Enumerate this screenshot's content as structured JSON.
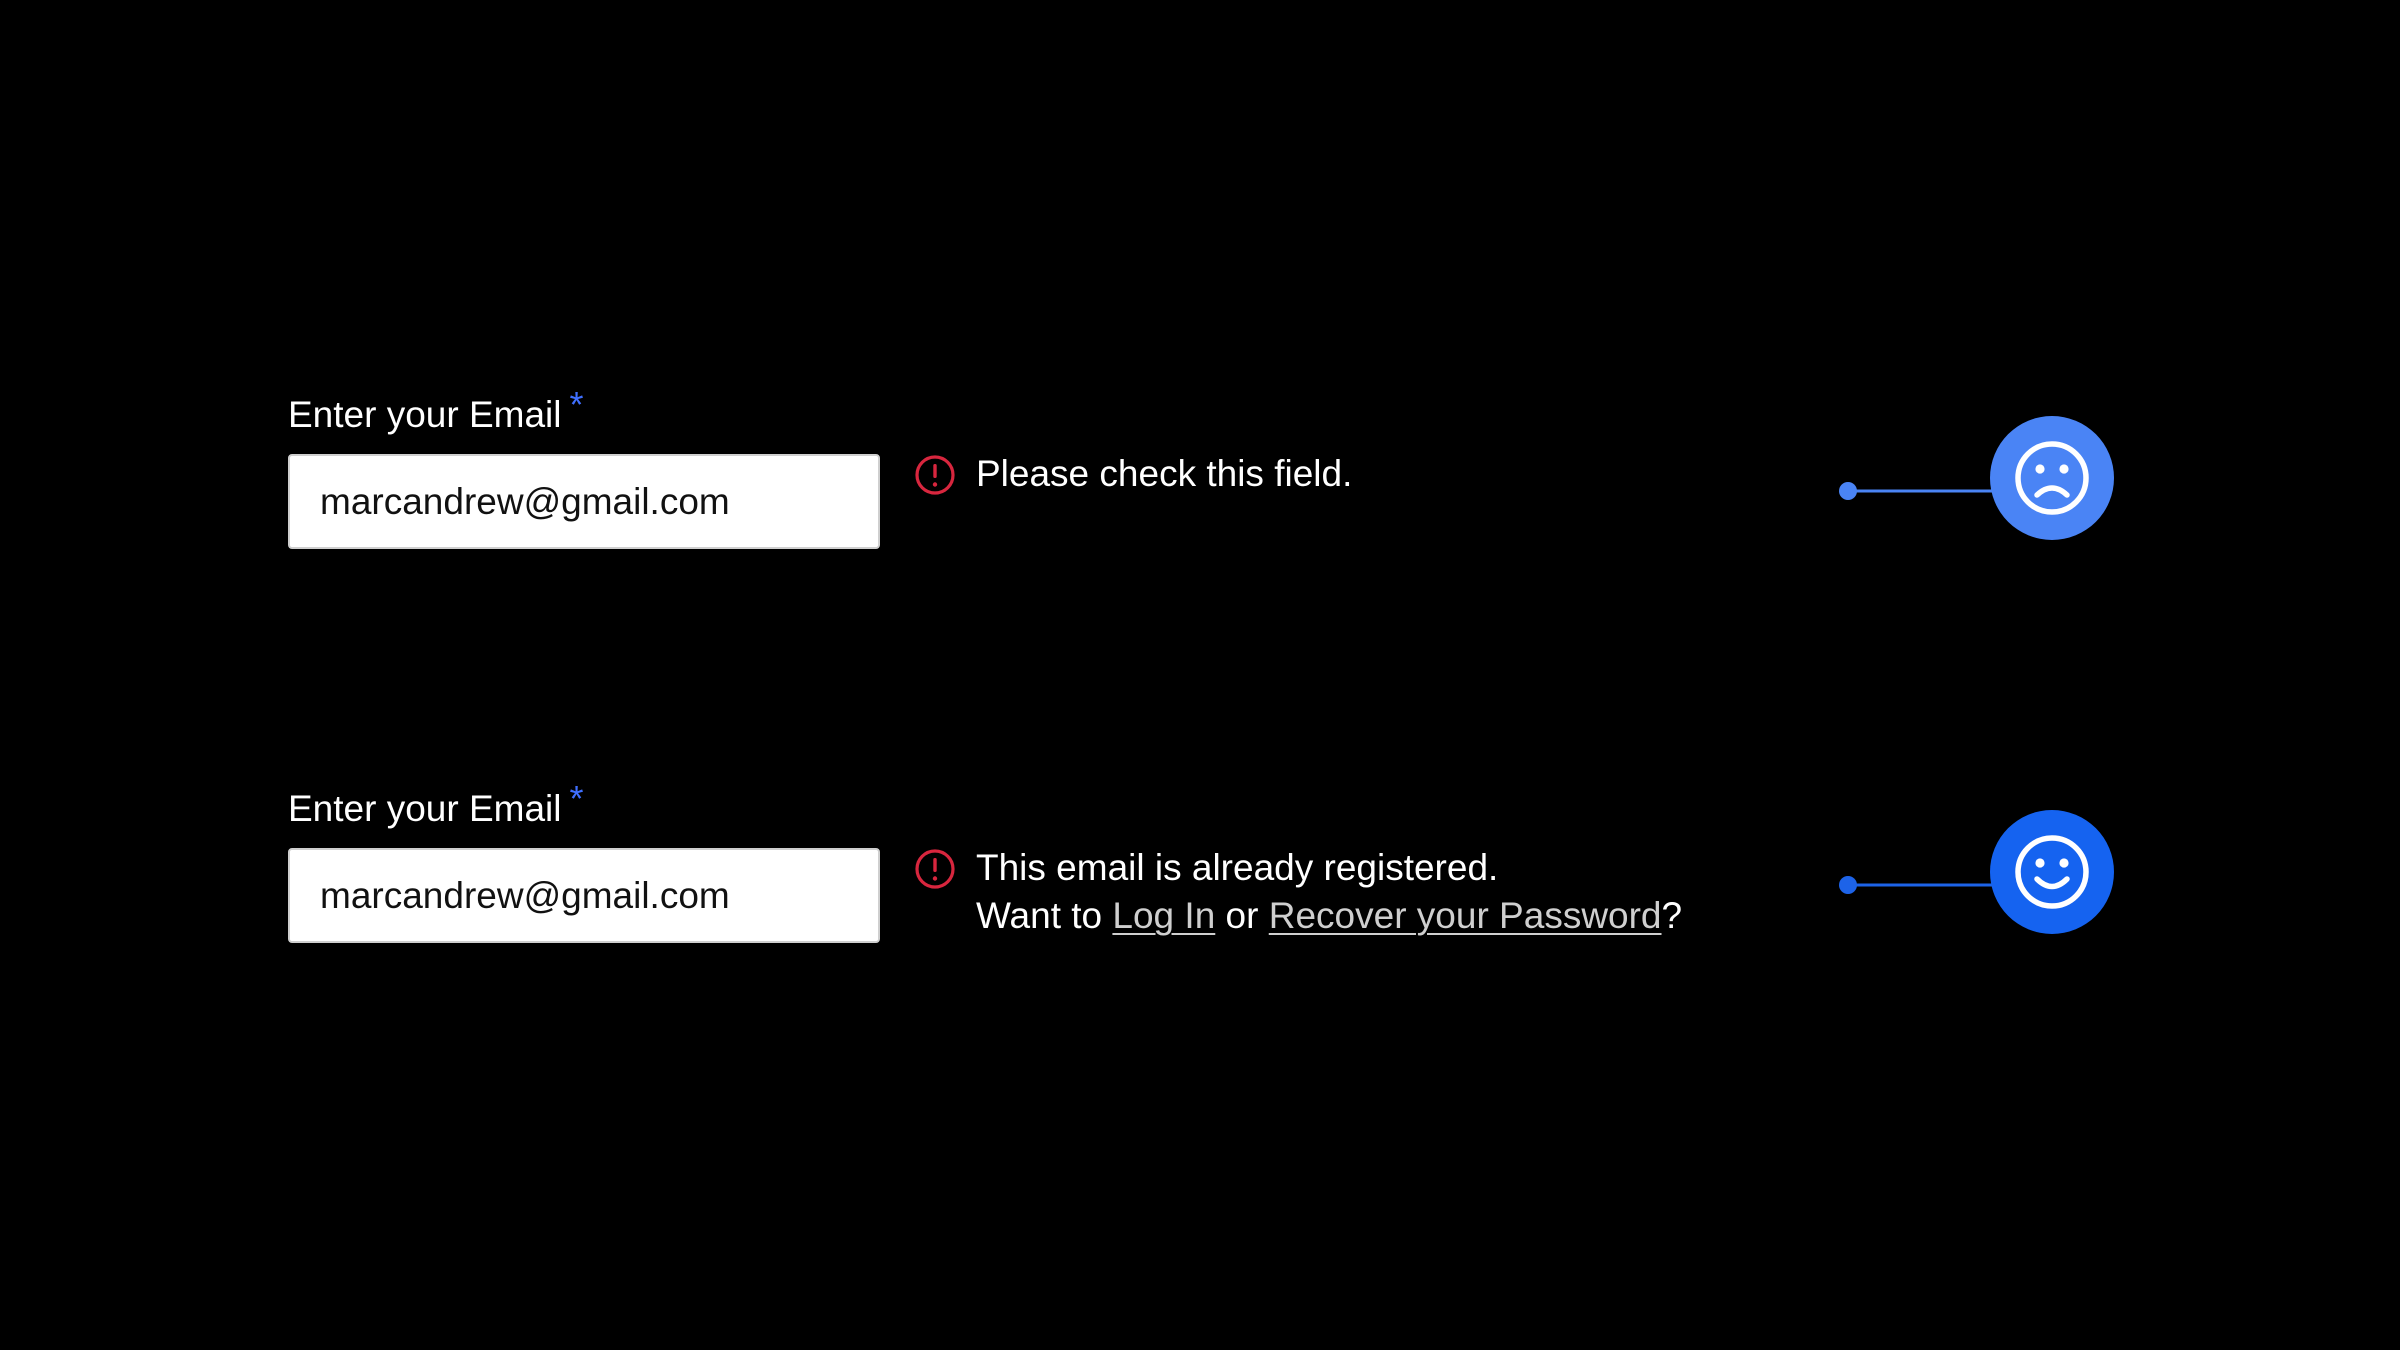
{
  "colors": {
    "background": "#000000",
    "required_asterisk": "#3f6fff",
    "error_red": "#d8263e",
    "sad_badge": "#4a84f5",
    "happy_badge": "#1563f0",
    "connector_sad": "#4a84f5",
    "connector_happy": "#1d63e8"
  },
  "rows": [
    {
      "label": "Enter your Email",
      "required_mark": "*",
      "input_value": "marcandrew@gmail.com",
      "error_icon": "exclamation-circle-icon",
      "error_message": "Please check this field.",
      "face_icon": "sad-face-icon"
    },
    {
      "label": "Enter your Email",
      "required_mark": "*",
      "input_value": "marcandrew@gmail.com",
      "error_icon": "exclamation-circle-icon",
      "error_message": "This email is already registered.",
      "followup_prefix": "Want to ",
      "login_link": "Log In",
      "followup_middle": " or ",
      "recover_link": "Recover your Password",
      "followup_suffix": "?",
      "face_icon": "happy-face-icon"
    }
  ]
}
